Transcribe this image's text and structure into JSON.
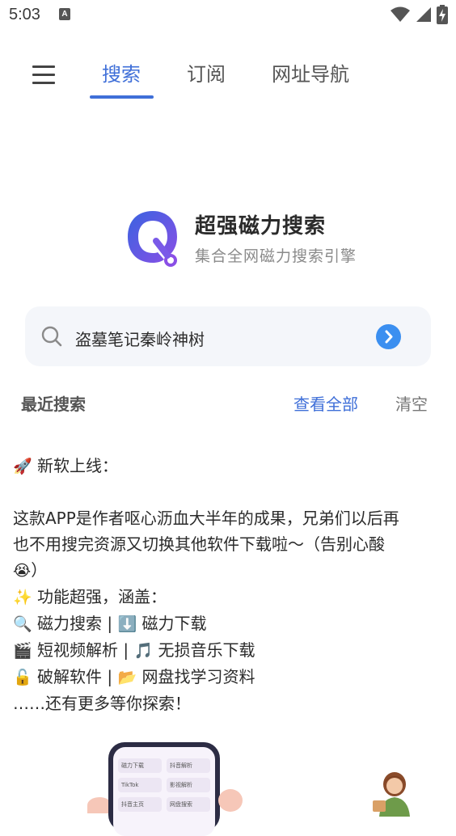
{
  "status_bar": {
    "time": "5:03",
    "notification_icon": "A",
    "icons": [
      "wifi-icon",
      "cell-signal-icon",
      "battery-charging-icon"
    ]
  },
  "nav": {
    "menu_icon": "hamburger-menu-icon",
    "tabs": [
      {
        "label": "搜索",
        "active": true
      },
      {
        "label": "订阅",
        "active": false
      },
      {
        "label": "网址导航",
        "active": false
      }
    ]
  },
  "brand": {
    "title": "超强磁力搜索",
    "subtitle": "集合全网磁力搜索引擎",
    "logo_icon": "q-magnifier-logo"
  },
  "search": {
    "value": "盗墓笔记秦岭神树",
    "search_icon": "search-icon",
    "go_icon": "chevron-right-circle-icon"
  },
  "recent": {
    "title": "最近搜索",
    "view_all": "查看全部",
    "clear": "清空"
  },
  "announcement": {
    "heading_emoji": "🚀",
    "heading": "新软上线：",
    "body_line1": "这款APP是作者呕心沥血大半年的成果，兄弟们以后再",
    "body_line2": "也不用搜完资源又切换其他软件下载啦～（告别心酸",
    "body_line3_emoji": "😭",
    "body_line3": "）",
    "features_emoji": "✨",
    "features_title": "功能超强，涵盖：",
    "f1_emoji": "🔍",
    "f1": "磁力搜索 |",
    "f2_emoji": "⬇️",
    "f2": "磁力下载",
    "f3_emoji": "🎬",
    "f3": "短视频解析 |",
    "f4_emoji": "🎵",
    "f4": "无损音乐下载",
    "f5_emoji": "🔓",
    "f5": "破解软件 |",
    "f6_emoji": "📂",
    "f6": "网盘找学习资料",
    "closing": "……还有更多等你探索！"
  },
  "illustration": {
    "cells": [
      "磁力下载",
      "抖音解析",
      "TikTok",
      "影视解析",
      "抖音主页",
      "网盘搜索"
    ]
  },
  "colors": {
    "accent": "#3f6fd8",
    "go_button": "#3b8ff0",
    "search_bg": "#f4f6fa",
    "logo_blue": "#3a63e0",
    "logo_purple": "#8a4fe6"
  }
}
